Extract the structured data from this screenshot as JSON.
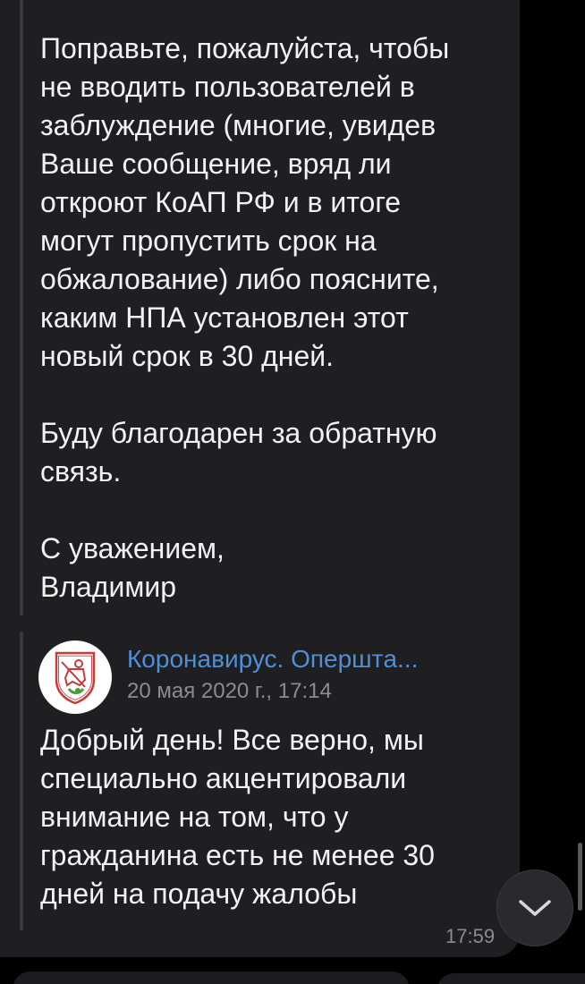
{
  "message": {
    "text_main": "Поправьте, пожалуйста, чтобы\nне вводить пользователей в\nзаблуждение (многие, увидев\nВаше сообщение, вряд ли\nоткроют КоАП РФ и в итоге\nмогут пропустить срок на\nобжалование) либо поясните,\nкаким НПА установлен этот\nновый срок в 30 дней.\n\nБуду благодарен за обратную\nсвязь.\n\nС уважением,\nВладимир",
    "reply_sender": "Коронавирус. Оперштаб Москвы",
    "reply_sender_display": "Коронавирус. Оперштa...",
    "reply_date": "20 мая 2020 г., 17:14",
    "reply_text": "Добрый день! Все верно, мы\nспециально акцентировали\nвнимание на том, что у\nгражданина есть не менее 30\nдней на подачу жалобы",
    "time": "17:59"
  },
  "icons": {
    "avatar": "moscow-coat-of-arms-icon",
    "scroll_down": "chevron-down-icon"
  },
  "colors": {
    "background": "#000000",
    "bubble": "#1f1f21",
    "text": "#f2f2f2",
    "link": "#4f8fd8",
    "muted": "#8c8c90"
  }
}
